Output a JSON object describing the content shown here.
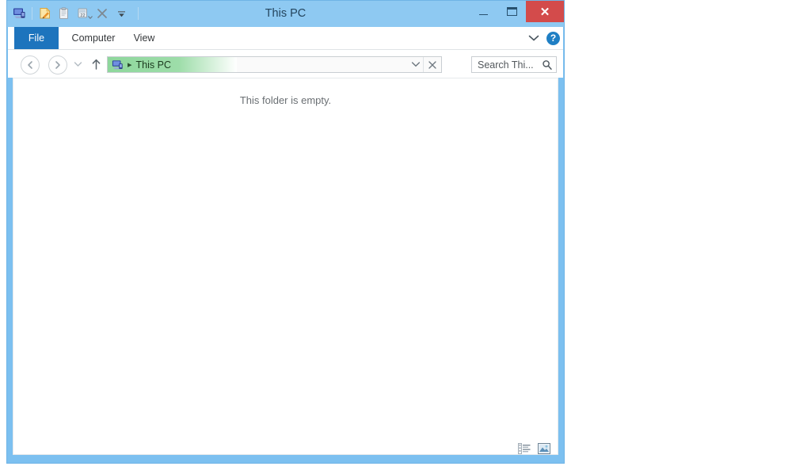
{
  "window": {
    "title": "This PC",
    "frame_color": "#7cc0f0",
    "titlebar_color": "#8ec9f2",
    "close_color": "#d34b4b",
    "accent_color": "#1d74bd"
  },
  "quick_access_toolbar": {
    "items": [
      {
        "name": "this-pc-icon",
        "label": "This PC"
      },
      {
        "name": "properties-icon",
        "label": "Properties"
      },
      {
        "name": "paste-icon",
        "label": "Paste"
      },
      {
        "name": "rename-icon",
        "label": "Rename"
      },
      {
        "name": "delete-icon",
        "label": "Delete"
      },
      {
        "name": "customize-dropdown-icon",
        "label": "Customize Quick Access Toolbar"
      }
    ]
  },
  "window_controls": {
    "minimize": "–",
    "maximize": "❐",
    "close": "✕"
  },
  "ribbon": {
    "tabs": [
      {
        "label": "File",
        "selected": true
      },
      {
        "label": "Computer",
        "selected": false
      },
      {
        "label": "View",
        "selected": false
      }
    ],
    "expand_icon": "chevron-down-icon",
    "help_label": "?"
  },
  "navigation": {
    "back_label": "Back",
    "forward_label": "Forward",
    "recent_label": "Recent locations",
    "up_label": "Up one level"
  },
  "address_bar": {
    "crumb_separator": "▸",
    "crumb_label": "This PC",
    "dropdown_label": "Previous locations",
    "stop_label": "Stop"
  },
  "search": {
    "placeholder": "Search Thi...",
    "value": "",
    "icon": "search-icon"
  },
  "content": {
    "empty_message": "This folder is empty."
  },
  "status_bar": {
    "views": [
      {
        "name": "details-view-button",
        "label": "Details view"
      },
      {
        "name": "large-icons-view-button",
        "label": "Large icons view"
      }
    ]
  }
}
